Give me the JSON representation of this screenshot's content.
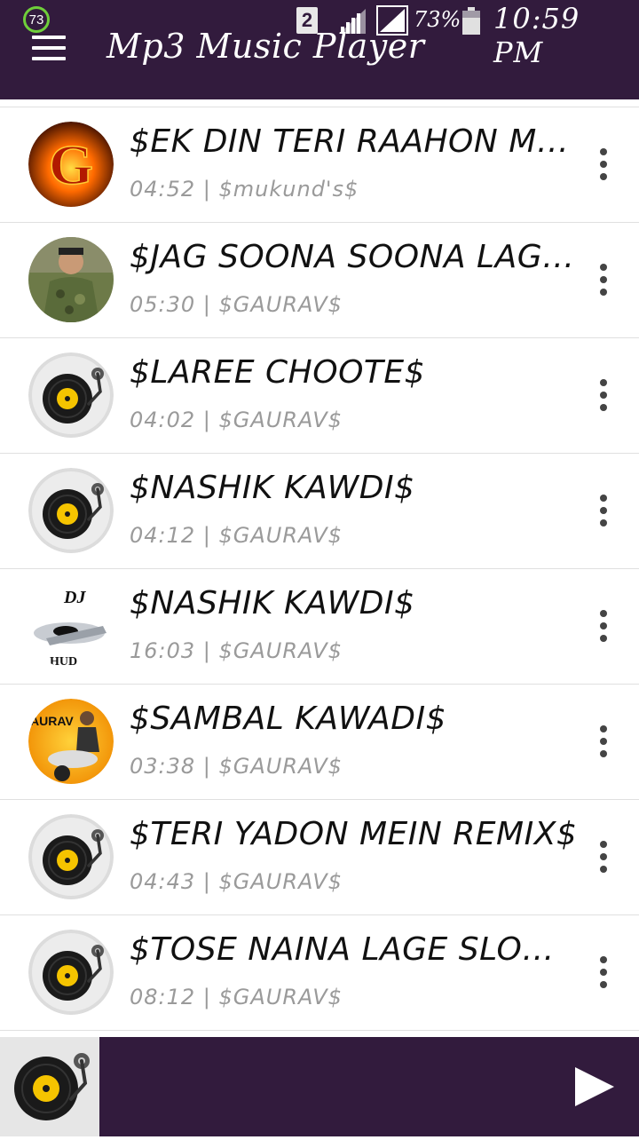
{
  "status_bar": {
    "notification_count": "73",
    "sim_label": "2",
    "battery_percent": "73%",
    "time": "10:59 PM"
  },
  "app": {
    "title": "Mp3 Music Player"
  },
  "songs": [
    {
      "title": "$EK DIN TERI RAAHON MAIN$",
      "duration": "04:52",
      "artist": "$mukund's$",
      "art": "fire-g"
    },
    {
      "title": "$JAG SOONA SOONA LAGE$",
      "duration": "05:30",
      "artist": "$GAURAV$",
      "art": "photo-soldier"
    },
    {
      "title": "$LAREE CHOOTE$",
      "duration": "04:02",
      "artist": "$GAURAV$",
      "art": "turntable"
    },
    {
      "title": "$NASHIK KAWDI$",
      "duration": "04:12",
      "artist": "$GAURAV$",
      "art": "turntable"
    },
    {
      "title": "$NASHIK KAWDI$",
      "duration": "16:03",
      "artist": "$GAURAV$",
      "art": "dj-logo"
    },
    {
      "title": "$SAMBAL KAWADI$",
      "duration": "03:38",
      "artist": "$GAURAV$",
      "art": "dj-gaurav"
    },
    {
      "title": "$TERI YADON MEIN REMIX$",
      "duration": "04:43",
      "artist": "$GAURAV$",
      "art": "turntable"
    },
    {
      "title": "$TOSE NAINA LAGE SLOW REMIX$",
      "duration": "08:12",
      "artist": "$GAURAV$",
      "art": "turntable"
    }
  ],
  "colors": {
    "primary": "#321b3d",
    "accent_yellow": "#f5c400",
    "meta_gray": "#9a9a9a"
  },
  "icons": {
    "menu": "hamburger-icon",
    "more": "more-vert-icon",
    "play": "play-icon"
  }
}
